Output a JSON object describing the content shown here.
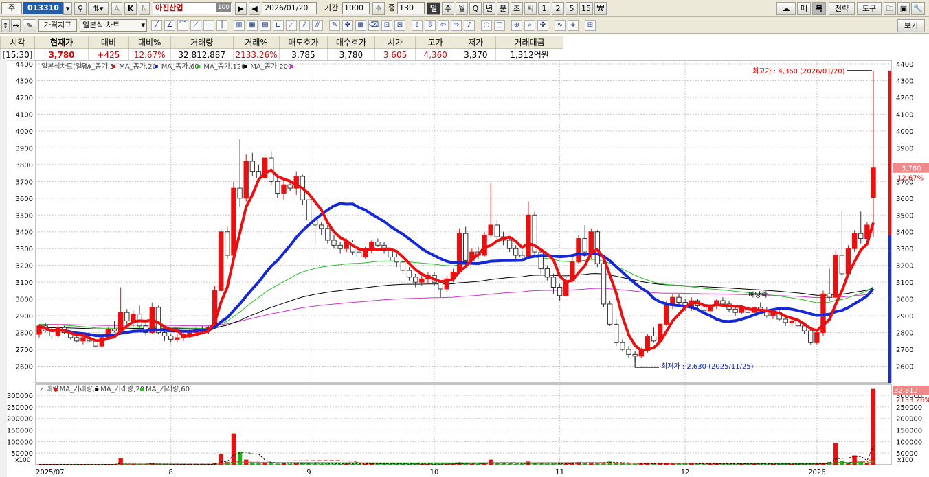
{
  "toolbar_top": {
    "market_label": "주",
    "stock_code": "013310",
    "stock_name": "아진산업",
    "name_badge": "100",
    "date_value": "2026/01/20",
    "period_label": "기간",
    "period_value": "1000",
    "middle_label": "중",
    "middle_value": "130",
    "intervals": [
      "일",
      "주",
      "월",
      "Q",
      "년",
      "분",
      "초",
      "틱",
      "1",
      "2",
      "5",
      "15",
      "₩"
    ],
    "active_interval": "일",
    "k_label": "K",
    "n_label": "N",
    "a_label": "A",
    "right_buttons": [
      "매",
      "복",
      "전략",
      "도구"
    ]
  },
  "toolbar_second": {
    "indicator_label": "가격지표",
    "chart_type_value": "일본식 차트",
    "view_button": "보기"
  },
  "quote_header": {
    "columns": [
      "시각",
      "현재가",
      "대비",
      "대비%",
      "거래량",
      "거래%",
      "매도호가",
      "매수호가",
      "시가",
      "고가",
      "저가",
      "거래대금"
    ],
    "values": [
      "[15:30]",
      "3,780",
      "+425",
      "12.67%",
      "32,812,887",
      "2133.26%",
      "3,785",
      "3,780",
      "3,605",
      "4,360",
      "3,370",
      "1,312억원"
    ]
  },
  "colors": {
    "up": "#e81010",
    "down": "#1e2fd0",
    "ma5": "#e81010",
    "ma20": "#1428d8",
    "ma60": "#22c022",
    "ma120": "#000000",
    "ma200": "#d030d0"
  },
  "chart_data": {
    "type": "candlestick",
    "title": "일본식차트(일간)",
    "legend": [
      "MA_종가,5",
      "MA_종가,20",
      "MA_종가,60",
      "MA_종가,120",
      "MA_종가,200"
    ],
    "price_axis": {
      "min": 2500,
      "max": 4400,
      "ticks": [
        2600,
        2700,
        2800,
        2900,
        3000,
        3100,
        3200,
        3300,
        3400,
        3500,
        3600,
        3700,
        3800,
        3900,
        4000,
        4100,
        4200,
        4300,
        4400
      ]
    },
    "x_labels": [
      "2025/07",
      "8",
      "9",
      "10",
      "11",
      "12",
      "2026"
    ],
    "current_price_label": "3,780",
    "current_pct_label": "12.67%",
    "high_annotation": "최고가 : 4,360 (2026/01/20)",
    "low_annotation": "최저가 : 2,630 (2025/11/25)",
    "dividend_annotation": "배당락",
    "candles": [
      [
        2790,
        2850,
        2770,
        2840
      ],
      [
        2840,
        2860,
        2800,
        2810
      ],
      [
        2810,
        2830,
        2770,
        2780
      ],
      [
        2780,
        2850,
        2770,
        2830
      ],
      [
        2830,
        2840,
        2790,
        2800
      ],
      [
        2800,
        2810,
        2760,
        2770
      ],
      [
        2770,
        2790,
        2740,
        2750
      ],
      [
        2750,
        2780,
        2730,
        2770
      ],
      [
        2770,
        2800,
        2740,
        2750
      ],
      [
        2750,
        2760,
        2710,
        2720
      ],
      [
        2720,
        2780,
        2710,
        2770
      ],
      [
        2770,
        2830,
        2760,
        2820
      ],
      [
        2820,
        2870,
        2800,
        2810
      ],
      [
        2810,
        3070,
        2800,
        2920
      ],
      [
        2920,
        2940,
        2840,
        2870
      ],
      [
        2870,
        2930,
        2830,
        2910
      ],
      [
        2910,
        2960,
        2820,
        2840
      ],
      [
        2840,
        2860,
        2780,
        2800
      ],
      [
        2800,
        2980,
        2790,
        2950
      ],
      [
        2950,
        2960,
        2790,
        2800
      ],
      [
        2800,
        2810,
        2750,
        2780
      ],
      [
        2780,
        2790,
        2740,
        2760
      ],
      [
        2760,
        2790,
        2740,
        2770
      ],
      [
        2770,
        2800,
        2750,
        2790
      ],
      [
        2790,
        2820,
        2770,
        2800
      ],
      [
        2800,
        2830,
        2780,
        2820
      ],
      [
        2820,
        2840,
        2790,
        2810
      ],
      [
        2810,
        2840,
        2790,
        2830
      ],
      [
        2830,
        3080,
        2820,
        3050
      ],
      [
        3050,
        3420,
        3040,
        3400
      ],
      [
        3400,
        3430,
        3240,
        3260
      ],
      [
        3260,
        3700,
        3250,
        3660
      ],
      [
        3660,
        3950,
        3550,
        3600
      ],
      [
        3600,
        3860,
        3580,
        3820
      ],
      [
        3820,
        3870,
        3730,
        3760
      ],
      [
        3760,
        3800,
        3700,
        3720
      ],
      [
        3720,
        3860,
        3690,
        3840
      ],
      [
        3840,
        3880,
        3680,
        3700
      ],
      [
        3700,
        3720,
        3600,
        3630
      ],
      [
        3630,
        3720,
        3590,
        3680
      ],
      [
        3680,
        3700,
        3640,
        3660
      ],
      [
        3660,
        3760,
        3620,
        3730
      ],
      [
        3730,
        3740,
        3560,
        3590
      ],
      [
        3590,
        3610,
        3440,
        3470
      ],
      [
        3470,
        3500,
        3330,
        3440
      ],
      [
        3440,
        3460,
        3380,
        3420
      ],
      [
        3420,
        3440,
        3330,
        3350
      ],
      [
        3350,
        3380,
        3300,
        3320
      ],
      [
        3320,
        3340,
        3270,
        3300
      ],
      [
        3300,
        3360,
        3280,
        3340
      ],
      [
        3340,
        3350,
        3260,
        3280
      ],
      [
        3280,
        3300,
        3230,
        3250
      ],
      [
        3250,
        3310,
        3240,
        3290
      ],
      [
        3290,
        3350,
        3270,
        3340
      ],
      [
        3340,
        3360,
        3310,
        3320
      ],
      [
        3320,
        3340,
        3270,
        3290
      ],
      [
        3290,
        3300,
        3230,
        3250
      ],
      [
        3250,
        3270,
        3190,
        3220
      ],
      [
        3220,
        3250,
        3150,
        3170
      ],
      [
        3170,
        3190,
        3110,
        3130
      ],
      [
        3130,
        3150,
        3070,
        3100
      ],
      [
        3100,
        3140,
        3080,
        3120
      ],
      [
        3120,
        3160,
        3090,
        3140
      ],
      [
        3140,
        3160,
        3080,
        3100
      ],
      [
        3100,
        3110,
        3010,
        3060
      ],
      [
        3060,
        3140,
        3040,
        3120
      ],
      [
        3120,
        3180,
        3100,
        3160
      ],
      [
        3160,
        3420,
        3150,
        3390
      ],
      [
        3390,
        3430,
        3200,
        3230
      ],
      [
        3230,
        3300,
        3210,
        3280
      ],
      [
        3280,
        3310,
        3240,
        3260
      ],
      [
        3260,
        3400,
        3250,
        3380
      ],
      [
        3380,
        3690,
        3370,
        3440
      ],
      [
        3440,
        3470,
        3350,
        3370
      ],
      [
        3370,
        3400,
        3320,
        3350
      ],
      [
        3350,
        3370,
        3280,
        3300
      ],
      [
        3300,
        3320,
        3230,
        3260
      ],
      [
        3260,
        3290,
        3220,
        3250
      ],
      [
        3250,
        3580,
        3240,
        3500
      ],
      [
        3500,
        3520,
        3260,
        3280
      ],
      [
        3280,
        3300,
        3150,
        3180
      ],
      [
        3180,
        3200,
        3110,
        3130
      ],
      [
        3130,
        3150,
        3030,
        3070
      ],
      [
        3070,
        3090,
        2990,
        3020
      ],
      [
        3020,
        3130,
        3010,
        3110
      ],
      [
        3110,
        3250,
        3100,
        3220
      ],
      [
        3220,
        3380,
        3210,
        3360
      ],
      [
        3360,
        3440,
        3250,
        3280
      ],
      [
        3280,
        3420,
        3240,
        3400
      ],
      [
        3400,
        3410,
        3190,
        3210
      ],
      [
        3210,
        3230,
        2950,
        2970
      ],
      [
        2970,
        2990,
        2840,
        2850
      ],
      [
        2850,
        2880,
        2720,
        2740
      ],
      [
        2740,
        2760,
        2690,
        2700
      ],
      [
        2700,
        2720,
        2650,
        2670
      ],
      [
        2670,
        2690,
        2630,
        2660
      ],
      [
        2660,
        2710,
        2650,
        2690
      ],
      [
        2690,
        2790,
        2680,
        2780
      ],
      [
        2780,
        2830,
        2740,
        2750
      ],
      [
        2750,
        2860,
        2740,
        2850
      ],
      [
        2850,
        2990,
        2840,
        2960
      ],
      [
        2960,
        3030,
        2940,
        3010
      ],
      [
        3010,
        3030,
        2960,
        2980
      ],
      [
        2980,
        3000,
        2930,
        2950
      ],
      [
        2950,
        3010,
        2930,
        2990
      ],
      [
        2990,
        3000,
        2930,
        2960
      ],
      [
        2960,
        2980,
        2910,
        2930
      ],
      [
        2930,
        2970,
        2910,
        2960
      ],
      [
        2960,
        3000,
        2940,
        2990
      ],
      [
        2990,
        3010,
        2950,
        2970
      ],
      [
        2970,
        2990,
        2920,
        2940
      ],
      [
        2940,
        2960,
        2900,
        2920
      ],
      [
        2920,
        2960,
        2910,
        2950
      ],
      [
        2950,
        2970,
        2900,
        2920
      ],
      [
        2920,
        2960,
        2910,
        2950
      ],
      [
        2950,
        2980,
        2910,
        2930
      ],
      [
        2930,
        2950,
        2890,
        2900
      ],
      [
        2900,
        2940,
        2880,
        2920
      ],
      [
        2920,
        2940,
        2870,
        2880
      ],
      [
        2880,
        2900,
        2840,
        2860
      ],
      [
        2860,
        2890,
        2840,
        2870
      ],
      [
        2870,
        2880,
        2830,
        2840
      ],
      [
        2840,
        2860,
        2790,
        2810
      ],
      [
        2810,
        2830,
        2730,
        2740
      ],
      [
        2740,
        2810,
        2730,
        2800
      ],
      [
        2800,
        3050,
        2780,
        3030
      ],
      [
        3030,
        3180,
        2990,
        3010
      ],
      [
        3010,
        3290,
        3000,
        3260
      ],
      [
        3260,
        3530,
        3120,
        3150
      ],
      [
        3150,
        3320,
        3140,
        3300
      ],
      [
        3300,
        3410,
        3280,
        3390
      ],
      [
        3390,
        3520,
        3330,
        3360
      ],
      [
        3360,
        3460,
        3340,
        3440
      ],
      [
        3605,
        4360,
        3370,
        3780
      ]
    ],
    "volume_axis": {
      "min": 0,
      "max": 330000,
      "ticks": [
        50000,
        100000,
        150000,
        200000,
        250000,
        300000
      ],
      "unit": "x100"
    },
    "volume_title": "거래량",
    "volume_legend": [
      "MA_거래량,5",
      "MA_거래량,20",
      "MA_거래량,60"
    ],
    "volume_last_label": "32,812",
    "volume_pct_label": "2133.26%",
    "volume_unit_label": "x100",
    "volume_x100": [
      1500,
      1200,
      1000,
      1800,
      1300,
      1100,
      900,
      1000,
      800,
      900,
      1200,
      1500,
      1400,
      27000,
      3500,
      2500,
      3000,
      1600,
      6500,
      2200,
      1200,
      900,
      800,
      1000,
      1100,
      1200,
      1000,
      1300,
      7500,
      48000,
      12000,
      135000,
      56000,
      22000,
      8000,
      6000,
      9000,
      7000,
      5000,
      6000,
      4000,
      7000,
      6000,
      8000,
      5000,
      4000,
      5000,
      4000,
      3500,
      5000,
      4000,
      3500,
      4500,
      6000,
      4000,
      3500,
      3000,
      3500,
      4000,
      3000,
      2800,
      3000,
      3200,
      2800,
      3500,
      4000,
      5000,
      11000,
      7000,
      4000,
      3500,
      6000,
      22000,
      8000,
      5000,
      4000,
      3500,
      3000,
      14000,
      6000,
      5000,
      4000,
      5000,
      4500,
      5000,
      6000,
      12000,
      8000,
      9000,
      7000,
      10000,
      14000,
      8000,
      5000,
      4000,
      3500,
      4000,
      7000,
      5000,
      6000,
      9000,
      7000,
      5000,
      4000,
      5000,
      4000,
      3500,
      4000,
      5000,
      4000,
      3500,
      3000,
      4000,
      3500,
      4000,
      3500,
      3000,
      3500,
      3000,
      2800,
      3000,
      3500,
      4000,
      5000,
      4000,
      9000,
      12000,
      95000,
      18000,
      10000,
      40000,
      14000,
      8000,
      328129
    ]
  }
}
